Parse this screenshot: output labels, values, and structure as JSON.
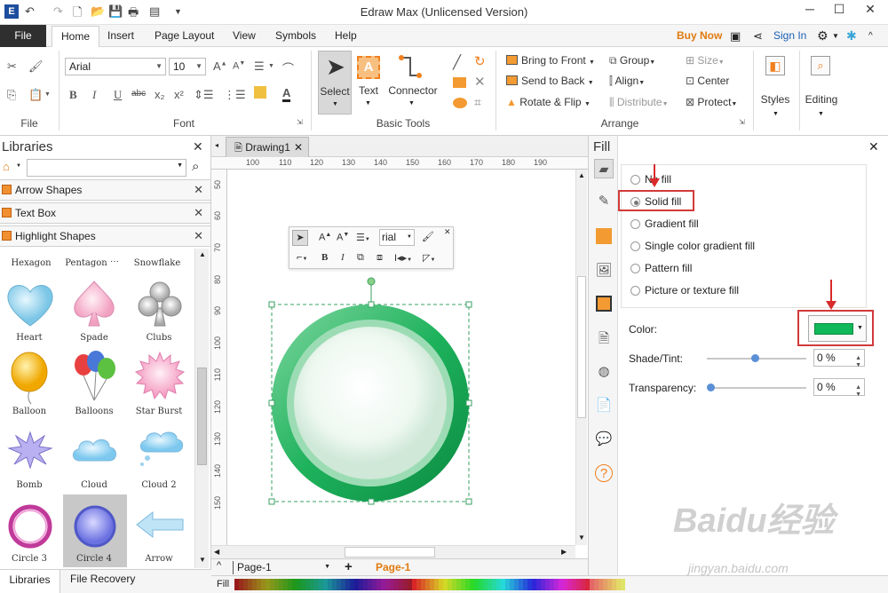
{
  "window": {
    "title": "Edraw Max (Unlicensed Version)"
  },
  "menu": {
    "file": "File",
    "items": [
      "Home",
      "Insert",
      "Page Layout",
      "View",
      "Symbols",
      "Help"
    ],
    "buy_now": "Buy Now",
    "sign_in": "Sign In"
  },
  "ribbon": {
    "groups": {
      "file": "File",
      "font": "Font",
      "basic_tools": "Basic Tools",
      "arrange": "Arrange"
    },
    "font_name": "Arial",
    "font_size": "10",
    "select": "Select",
    "text": "Text",
    "connector": "Connector",
    "bring_to_front": "Bring to Front",
    "send_to_back": "Send to Back",
    "rotate_flip": "Rotate & Flip",
    "group": "Group",
    "align": "Align",
    "distribute": "Distribute",
    "size": "Size",
    "center": "Center",
    "protect": "Protect",
    "styles": "Styles",
    "editing": "Editing",
    "bold": "B",
    "italic": "I",
    "underline": "U",
    "strike": "abc"
  },
  "libraries": {
    "title": "Libraries",
    "categories": [
      "Arrow Shapes",
      "Text Box",
      "Highlight Shapes"
    ],
    "shapes_top": [
      "Hexagon",
      "Pentagon",
      "Snowflake"
    ],
    "shapes": [
      "Heart",
      "Spade",
      "Clubs",
      "Balloon",
      "Balloons",
      "Star Burst",
      "Bomb",
      "Cloud",
      "Cloud 2",
      "Circle 3",
      "Circle 4",
      "Arrow"
    ],
    "bottom_tabs": [
      "Libraries",
      "File Recovery"
    ]
  },
  "canvas": {
    "doc_tab": "Drawing1",
    "ruler_h": [
      "100",
      "110",
      "120",
      "130",
      "140",
      "150",
      "160",
      "170",
      "180",
      "190"
    ],
    "ruler_v": [
      "50",
      "60",
      "70",
      "80",
      "90",
      "100",
      "110",
      "120",
      "130",
      "140",
      "150"
    ],
    "mini_font": "rial",
    "page_tab": "Page-1",
    "page_tab_active": "Page-1",
    "fill_label": "Fill"
  },
  "fill_panel": {
    "title": "Fill",
    "options": [
      "No fill",
      "Solid fill",
      "Gradient fill",
      "Single color gradient fill",
      "Pattern fill",
      "Picture or texture fill"
    ],
    "selected": "Solid fill",
    "color_label": "Color:",
    "shade_label": "Shade/Tint:",
    "shade_value": "0 %",
    "transparency_label": "Transparency:",
    "transparency_value": "0 %",
    "color_value": "#0fb858"
  },
  "watermark": {
    "main": "Baidu经验",
    "sub": "jingyan.baidu.com"
  }
}
